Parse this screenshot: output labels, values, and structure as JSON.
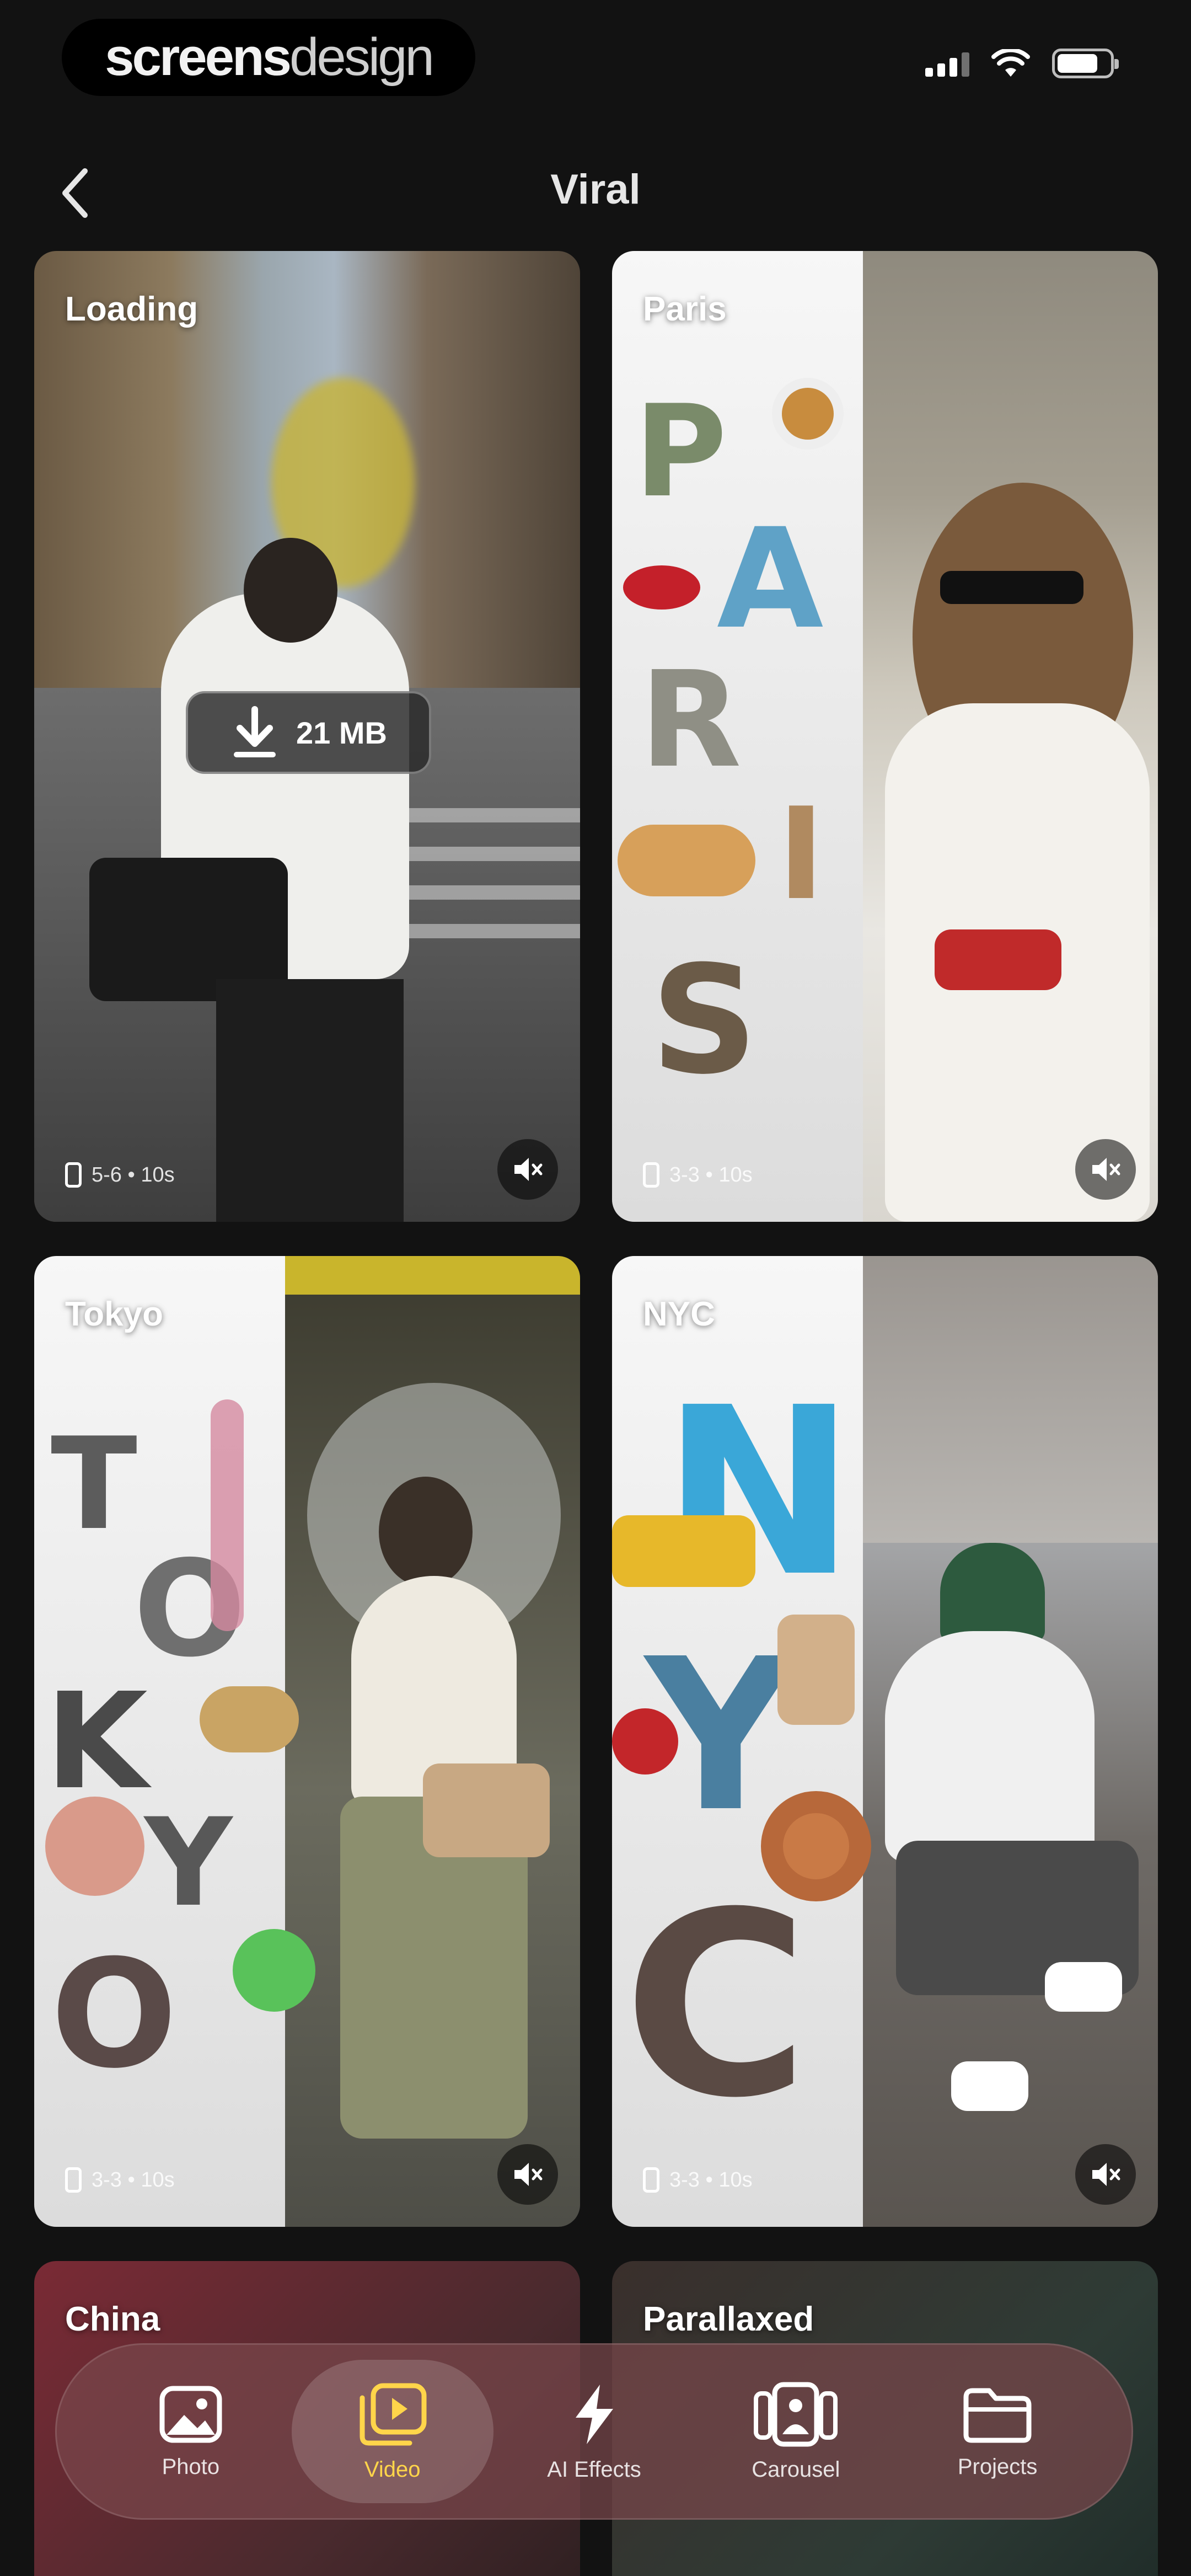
{
  "status_bar": {
    "brand_part1": "screens",
    "brand_part2": "design"
  },
  "header": {
    "title": "Viral"
  },
  "cards": [
    {
      "label": "Loading",
      "meta": "5-6 • 10s",
      "download": "21 MB",
      "state": "downloading"
    },
    {
      "label": "Paris",
      "meta": "3-3 • 10s",
      "collage_letters": [
        "P",
        "A",
        "R",
        "I",
        "S"
      ]
    },
    {
      "label": "Tokyo",
      "meta": "3-3 • 10s",
      "collage_letters": [
        "T",
        "O",
        "K",
        "Y",
        "O"
      ]
    },
    {
      "label": "NYC",
      "meta": "3-3 • 10s",
      "collage_letters": [
        "N",
        "Y",
        "C"
      ]
    },
    {
      "label": "China"
    },
    {
      "label": "Parallaxed"
    }
  ],
  "tabbar": {
    "items": [
      {
        "label": "Photo",
        "icon": "photo-icon"
      },
      {
        "label": "Video",
        "icon": "video-icon",
        "active": true
      },
      {
        "label": "AI Effects",
        "icon": "lightning-icon"
      },
      {
        "label": "Carousel",
        "icon": "carousel-icon"
      },
      {
        "label": "Projects",
        "icon": "folder-icon"
      }
    ]
  },
  "colors": {
    "background": "#121212",
    "active_tab_label": "#ffd54a",
    "tabbar_bg": "#784650"
  }
}
